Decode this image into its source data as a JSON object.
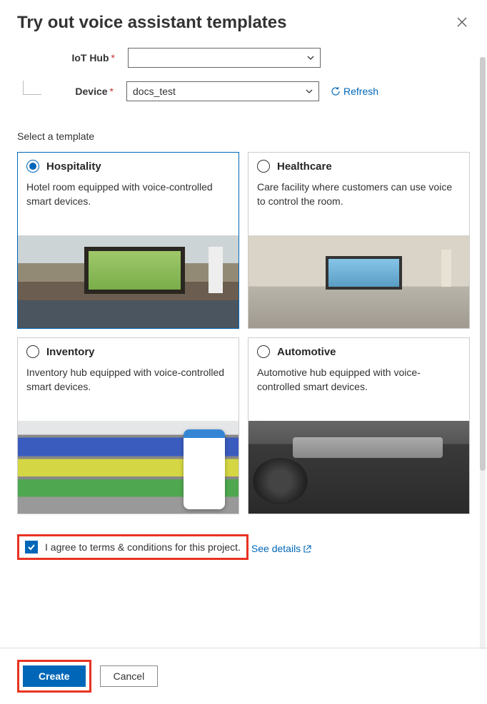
{
  "header": {
    "title": "Try out voice assistant templates"
  },
  "form": {
    "iot_hub_label": "IoT Hub",
    "iot_hub_value": "",
    "device_label": "Device",
    "device_value": "docs_test",
    "refresh_label": "Refresh"
  },
  "section": {
    "select_template_label": "Select a template"
  },
  "templates": [
    {
      "title": "Hospitality",
      "desc": "Hotel room equipped with voice-controlled smart devices.",
      "selected": true
    },
    {
      "title": "Healthcare",
      "desc": "Care facility where customers can use voice to control the room.",
      "selected": false
    },
    {
      "title": "Inventory",
      "desc": "Inventory hub equipped with voice-controlled smart devices.",
      "selected": false
    },
    {
      "title": "Automotive",
      "desc": "Automotive hub equipped with voice-controlled smart devices.",
      "selected": false
    }
  ],
  "terms": {
    "label": "I agree to terms & conditions for this project.",
    "see_details": "See details",
    "checked": true
  },
  "footer": {
    "create_label": "Create",
    "cancel_label": "Cancel"
  }
}
